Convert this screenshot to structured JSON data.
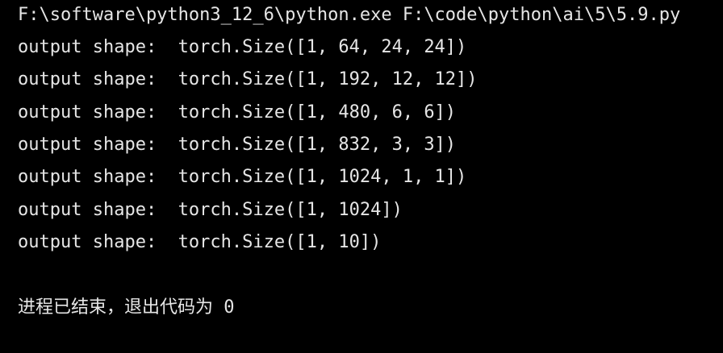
{
  "terminal": {
    "command": "F:\\software\\python3_12_6\\python.exe F:\\code\\python\\ai\\5\\5.9.py",
    "output_lines": [
      "output shape:  torch.Size([1, 64, 24, 24])",
      "output shape:  torch.Size([1, 192, 12, 12])",
      "output shape:  torch.Size([1, 480, 6, 6])",
      "output shape:  torch.Size([1, 832, 3, 3])",
      "output shape:  torch.Size([1, 1024, 1, 1])",
      "output shape:  torch.Size([1, 1024])",
      "output shape:  torch.Size([1, 10])"
    ],
    "exit_message": "进程已结束，退出代码为",
    "exit_code": "0"
  },
  "colors": {
    "background": "#000000",
    "text": "#e6e6e6"
  }
}
